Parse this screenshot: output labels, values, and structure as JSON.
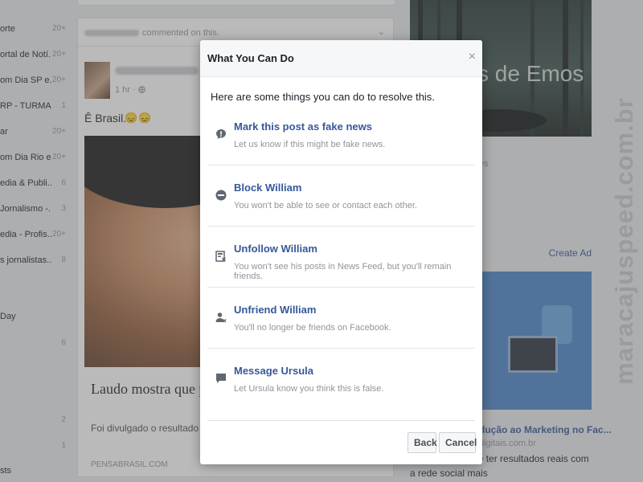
{
  "sidebar": {
    "items": [
      {
        "label": "orte",
        "count": "20+"
      },
      {
        "label": "ortal de Notí...",
        "count": "20+"
      },
      {
        "label": "om Dia SP e...",
        "count": "20+"
      },
      {
        "label": "RP - TURMA 5",
        "count": "1"
      },
      {
        "label": "ar",
        "count": "20+"
      },
      {
        "label": "om Dia Rio e...",
        "count": "20+"
      },
      {
        "label": "edia & Publi...",
        "count": "6"
      },
      {
        "label": "Jornalismo -...",
        "count": "3"
      },
      {
        "label": "edia - Profis...",
        "count": "20+"
      },
      {
        "label": "s jornalistas...",
        "count": "8"
      },
      {
        "label": "Day",
        "count": ""
      },
      {
        "label": "",
        "count": "6"
      },
      {
        "label": "",
        "count": "2"
      },
      {
        "label": "",
        "count": "1"
      },
      {
        "label": "sts",
        "count": ""
      }
    ]
  },
  "feed": {
    "notification_text": "commented on this.",
    "post_time": "1 hr ·",
    "post_text": "Ê Brasil...",
    "post_emoji": "😞😞",
    "link": {
      "title": "Laudo mostra que pil... envenenado",
      "description": "Foi divulgado o resultado do la... empresário Paulo Cesar de Ba...",
      "source": "PENSABRASIL.COM"
    }
  },
  "right_column": {
    "banner_text": "s de Emos",
    "gray_text": "es",
    "create_ad": "Create Ad",
    "ad_title": "dução ao Marketing no Fac...",
    "ad_domain": "digitais.com.br",
    "ad_description": "ráticas para você ter resultados reais com a rede social mais"
  },
  "watermark": "maracajuspeed.com.br",
  "modal": {
    "title": "What You Can Do",
    "close_glyph": "×",
    "intro": "Here are some things you can do to resolve this.",
    "options": [
      {
        "icon": "alert-bubble-icon",
        "title": "Mark this post as fake news",
        "description": "Let us know if this might be fake news."
      },
      {
        "icon": "block-icon",
        "title": "Block William",
        "description": "You won't be able to see or contact each other."
      },
      {
        "icon": "unfollow-icon",
        "title": "Unfollow William",
        "description": "You won't see his posts in News Feed, but you'll remain friends."
      },
      {
        "icon": "unfriend-icon",
        "title": "Unfriend William",
        "description": "You'll no longer be friends on Facebook."
      },
      {
        "icon": "message-icon",
        "title": "Message Ursula",
        "description": "Let Ursula know you think this is false."
      }
    ],
    "buttons": {
      "back": "Back",
      "cancel": "Cancel"
    }
  },
  "colors": {
    "link_blue": "#365899",
    "muted_gray": "#90949c",
    "icon_gray": "#606770",
    "overlay": "rgba(90,90,90,0.42)"
  }
}
